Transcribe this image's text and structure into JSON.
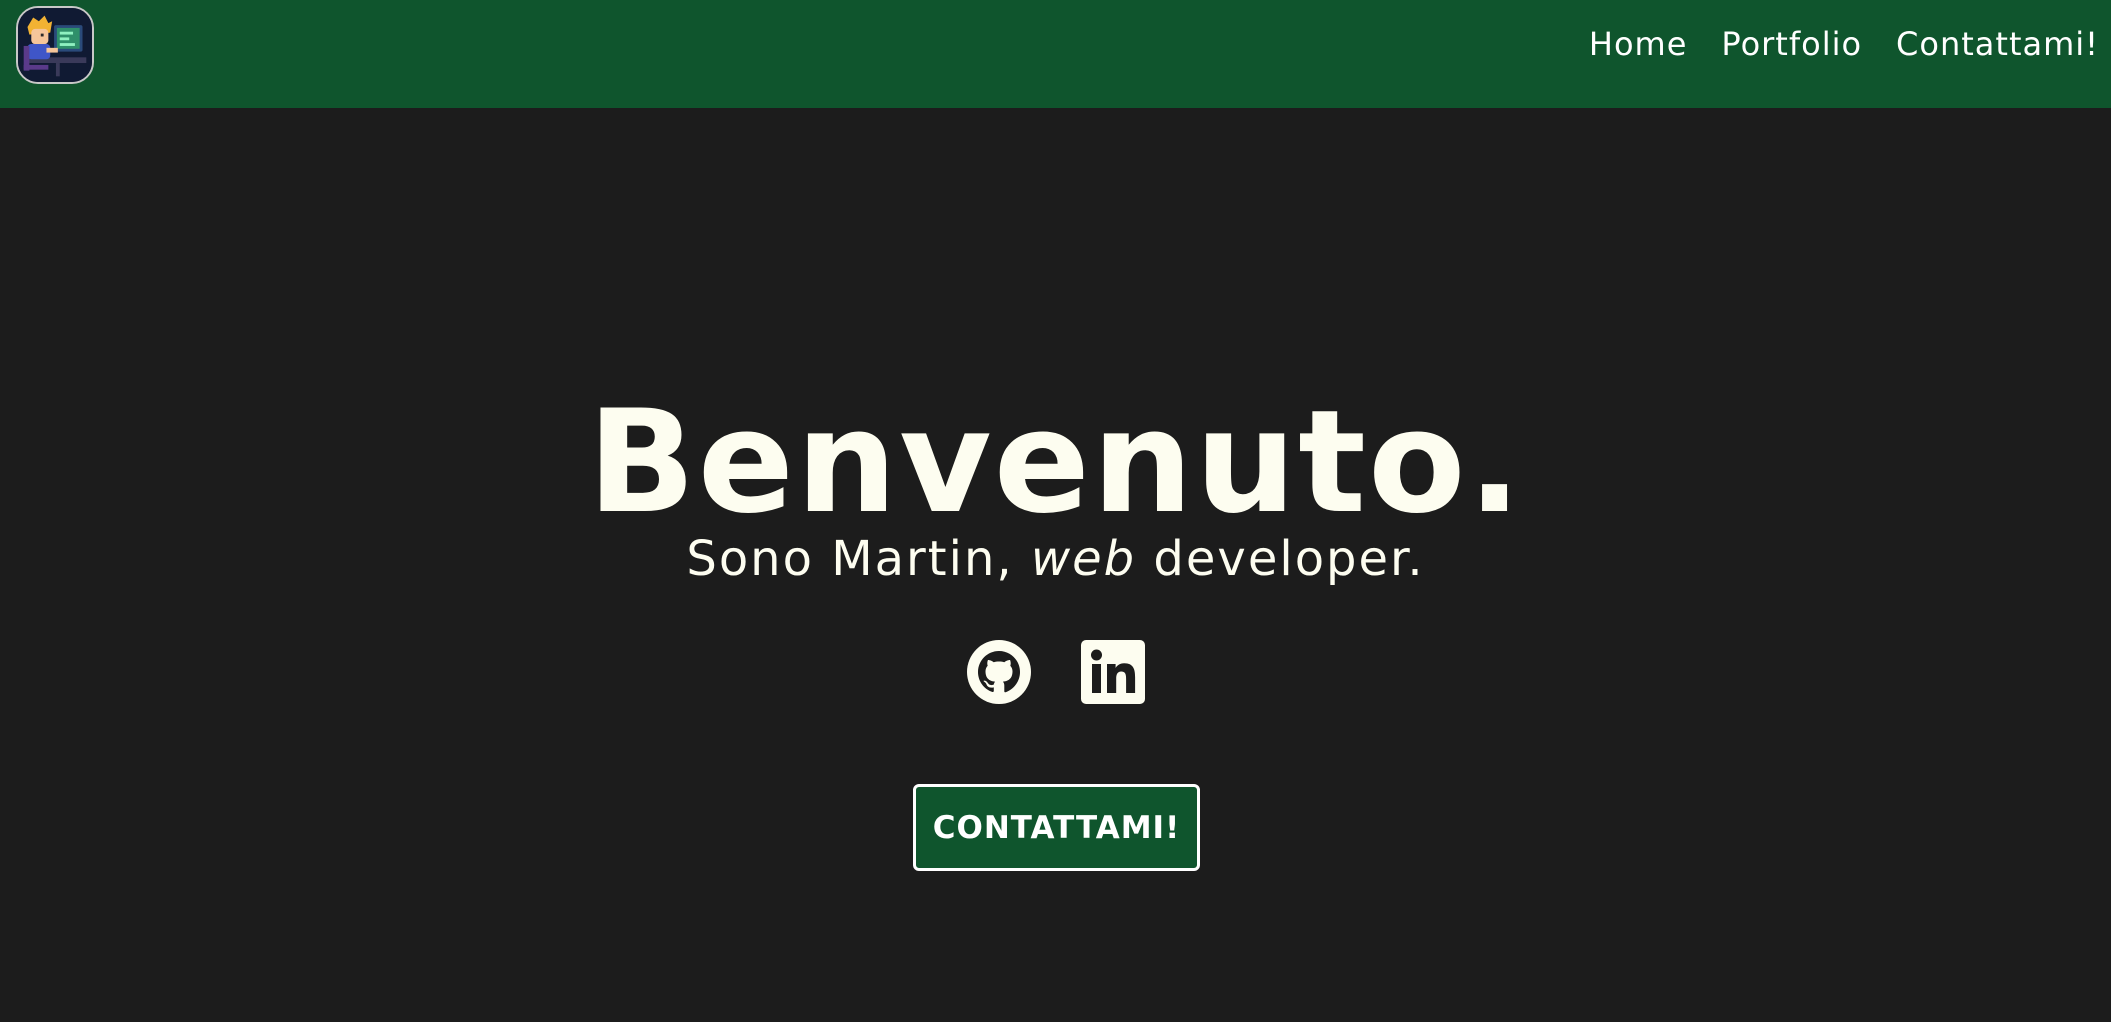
{
  "nav": {
    "links": [
      {
        "label": "Home"
      },
      {
        "label": "Portfolio"
      },
      {
        "label": "Contattami!"
      }
    ]
  },
  "hero": {
    "title": "Benvenuto.",
    "subtitle_prefix": "Sono Martin, ",
    "subtitle_emphasis": "web",
    "subtitle_suffix": " developer.",
    "cta_label": "CONTATTAMI!"
  },
  "social": [
    {
      "icon": "github-icon"
    },
    {
      "icon": "linkedin-icon"
    }
  ],
  "colors": {
    "nav_bg": "#0f552d",
    "page_bg": "#1c1c1c",
    "text": "#fdfdf0",
    "button_bg": "#0f552d",
    "button_border": "#ffffff"
  }
}
